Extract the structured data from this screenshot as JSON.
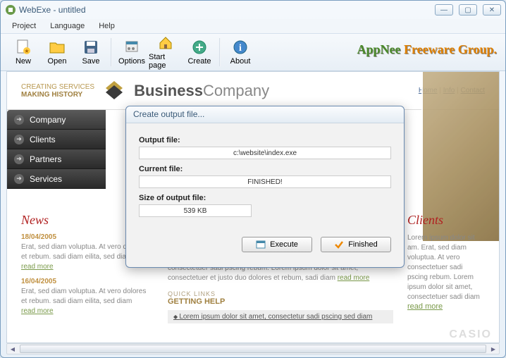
{
  "window": {
    "title": "WebExe - untitled"
  },
  "menu": {
    "items": [
      "Project",
      "Language",
      "Help"
    ]
  },
  "toolbar": {
    "items": [
      {
        "label": "New"
      },
      {
        "label": "Open"
      },
      {
        "label": "Save"
      },
      {
        "sep": true
      },
      {
        "label": "Options"
      },
      {
        "label": "Start page"
      },
      {
        "label": "Create"
      },
      {
        "sep": true
      },
      {
        "label": "About"
      }
    ],
    "brand1": "AppNee ",
    "brand2": "Freeware Group."
  },
  "page": {
    "tagline1": "CREATING SERVICES",
    "tagline2": "MAKING HISTORY",
    "brand_a": "Business",
    "brand_b": "Company",
    "links": [
      "Home",
      "Info",
      "Contact"
    ],
    "nav": [
      "Company",
      "Clients",
      "Partners",
      "Services"
    ],
    "news": {
      "title": "News",
      "items": [
        {
          "date": "18/04/2005",
          "text": "Erat, sed diam voluptua. At vero dolores et rebum. sadi diam eilita, sed diam ",
          "readmore": "read more"
        },
        {
          "date": "16/04/2005",
          "text": "Erat, sed diam voluptua. At vero dolores et rebum. sadi diam eilita, sed diam ",
          "readmore": "read more"
        }
      ]
    },
    "mid": {
      "text": "consectetuer sadi pscing rebum. Lorem ipsum dolor sit amet, consectetuer et justo duo dolores et rebum, sadi diam ",
      "readmore": "read more",
      "quick1": "QUICK LINKS",
      "quick2": "GETTING HELP",
      "link_row": "Lorem ipsum dolor sit amet, consectetur sadi pscing sed diam"
    },
    "clients": {
      "title": "Clients",
      "text": "Lorem ipsum dolor sit am. Erat, sed diam voluptua. At vero consectetuer sadi pscing rebum. Lorem ipsum dolor sit amet, consectetuer sadi diam",
      "readmore": "read more"
    },
    "casio": "CASIO"
  },
  "dialog": {
    "title": "Create output file...",
    "output_label": "Output file:",
    "output_value": "c:\\website\\index.exe",
    "current_label": "Current file:",
    "current_value": "FINISHED!",
    "size_label": "Size of output file:",
    "size_value": "539 KB",
    "execute": "Execute",
    "finished": "Finished"
  }
}
